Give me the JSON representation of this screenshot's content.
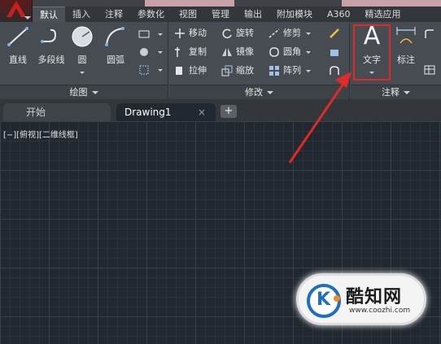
{
  "tabs": [
    "默认",
    "插入",
    "注释",
    "参数化",
    "视图",
    "管理",
    "输出",
    "附加模块",
    "A360",
    "精选应用"
  ],
  "draw_panel": {
    "title": "绘图",
    "tools": [
      "直线",
      "多段线",
      "圆",
      "圆弧"
    ]
  },
  "modify_panel": {
    "title": "修改",
    "rows": [
      [
        "移动",
        "旋转",
        "修剪"
      ],
      [
        "复制",
        "镜像",
        "圆角"
      ],
      [
        "拉伸",
        "缩放",
        "阵列"
      ]
    ]
  },
  "annotation_panel": {
    "title": "注释",
    "text_tool": {
      "glyph": "A",
      "label": "文字"
    },
    "dimension_tool": "标注"
  },
  "file_tabs": {
    "start": "开始",
    "current": "Drawing1",
    "close_glyph": "×",
    "new_glyph": "+"
  },
  "viewport_label": "[−][俯视][二维线框]",
  "watermark": {
    "brand": "酷知网",
    "url": "www.coozhi.com",
    "logo_letter": "K"
  },
  "colors": {
    "highlight_box": "#e02a2a",
    "arrow": "#e02a2a",
    "canvas": "#212830",
    "ribbon": "#474c52"
  }
}
